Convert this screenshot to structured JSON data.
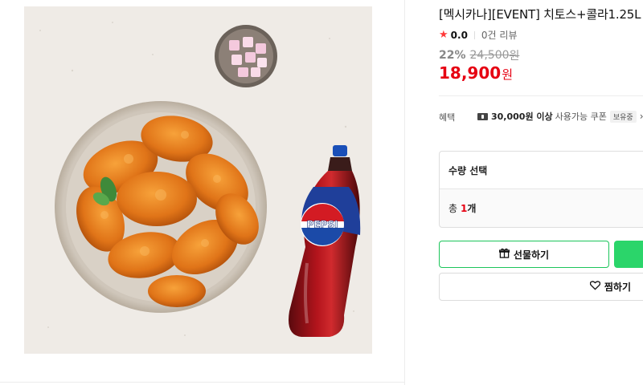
{
  "product": {
    "title": "[멕시카나][EVENT] 치토스+콜라1.25L",
    "rating": "0.0",
    "review_count": "0건 리뷰",
    "discount": "22%",
    "original_price": "24,500",
    "original_currency": "원",
    "price": "18,900",
    "currency": "원",
    "image_label": "PEPSI"
  },
  "benefit": {
    "label": "혜택",
    "amount": "30,000원 이상",
    "desc": "사용가능 쿠폰",
    "badge": "보유중"
  },
  "quantity": {
    "header": "수량 선택",
    "total_prefix": "총",
    "count": "1",
    "unit": "개"
  },
  "actions": {
    "gift_label": "선물하기",
    "wish_label": "찜하기"
  },
  "colors": {
    "accent_green": "#1bc55a",
    "price_red": "#e60012"
  }
}
